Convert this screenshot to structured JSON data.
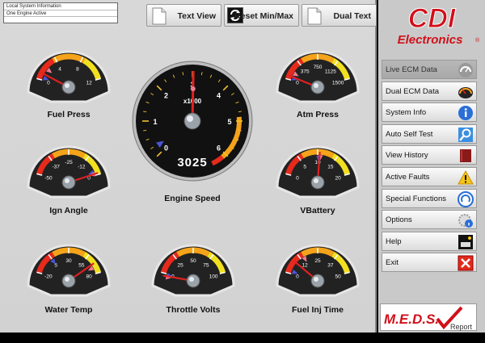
{
  "status_lines": [
    "Local System Information",
    "One Engine Active"
  ],
  "toolbar": {
    "text_view": "Text View",
    "reset_minmax": "Reset Min/Max",
    "dual_text": "Dual Text"
  },
  "gauges": {
    "fuel_press": {
      "label": "Fuel Press",
      "ticks": [
        "0",
        "4",
        "8",
        "12"
      ]
    },
    "atm_press": {
      "label": "Atm Press",
      "ticks": [
        "0",
        "375",
        "750",
        "1125",
        "1500"
      ]
    },
    "engine_speed": {
      "label": "Engine Speed",
      "ticks": [
        "0",
        "1",
        "2",
        "3",
        "4",
        "5",
        "6"
      ],
      "multiplier": "x1000",
      "value": "3025"
    },
    "ign_angle": {
      "label": "Ign Angle",
      "ticks": [
        "-50",
        "-37",
        "-25",
        "-12",
        "0"
      ]
    },
    "vbattery": {
      "label": "VBattery",
      "ticks": [
        "0",
        "5",
        "10",
        "15",
        "20"
      ]
    },
    "water_temp": {
      "label": "Water Temp",
      "ticks": [
        "-20",
        "5",
        "30",
        "55",
        "80"
      ]
    },
    "throttle_volts": {
      "label": "Throttle Volts",
      "ticks": [
        "0",
        "25",
        "50",
        "75",
        "100"
      ]
    },
    "fuel_inj_time": {
      "label": "Fuel Inj Time",
      "ticks": [
        "0",
        "12",
        "25",
        "37",
        "50"
      ]
    }
  },
  "brand": {
    "line1": "CDI",
    "line2": "Electronics",
    "mark": "®"
  },
  "menu": [
    {
      "label": "Live ECM Data",
      "icon": "gauge-icon",
      "active": true
    },
    {
      "label": "Dual ECM Data",
      "icon": "dual-gauge-icon",
      "active": false
    },
    {
      "label": "System Info",
      "icon": "info-icon",
      "active": false
    },
    {
      "label": "Auto Self Test",
      "icon": "magnifier-icon",
      "active": false
    },
    {
      "label": "View History",
      "icon": "book-icon",
      "active": false
    },
    {
      "label": "Active Faults",
      "icon": "warning-icon",
      "active": false
    },
    {
      "label": "Special Functions",
      "icon": "special-icon",
      "active": false
    },
    {
      "label": "Options",
      "icon": "gear-info-icon",
      "active": false
    },
    {
      "label": "Help",
      "icon": "help-icon",
      "active": false
    },
    {
      "label": "Exit",
      "icon": "close-icon",
      "active": false
    }
  ],
  "meds": {
    "brand": "M.E.D.S.",
    "report": "Report"
  },
  "colors": {
    "brand_red": "#d0101a",
    "needle_red": "#e02020",
    "min_blue": "#4a55d8",
    "max_pink": "#f07a90"
  }
}
